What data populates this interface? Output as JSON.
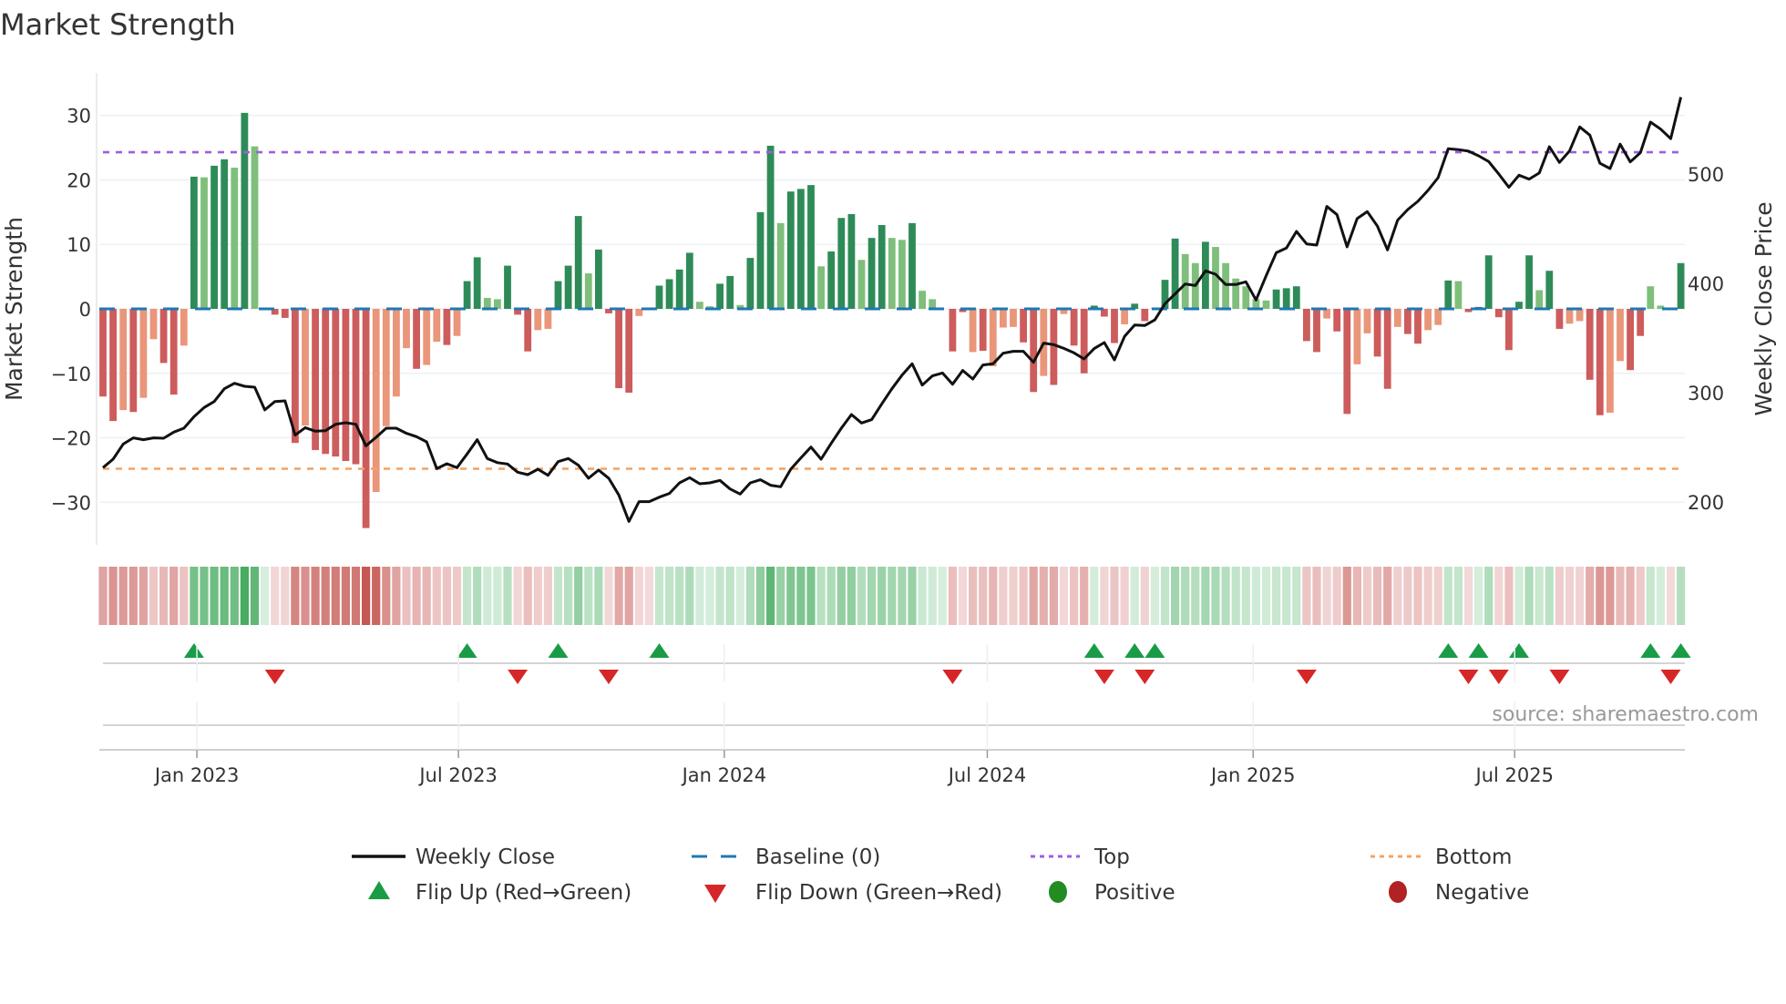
{
  "chart_data": {
    "type": "bar",
    "title": "Market Strength",
    "ylabel": "Market Strength",
    "y2label": "Weekly Close Price",
    "source": "source: sharemaestro.com",
    "start_date": "2022-10-28",
    "frequency": "weekly",
    "ylim": [
      -36.6,
      36.6
    ],
    "y2lim": [
      160.8,
      592.5
    ],
    "yticks": [
      {
        "value": 30,
        "label": "30"
      },
      {
        "value": 20,
        "label": "20"
      },
      {
        "value": 10,
        "label": "10"
      },
      {
        "value": 0,
        "label": "0"
      },
      {
        "value": -10,
        "label": "−10"
      },
      {
        "value": -20,
        "label": "−20"
      },
      {
        "value": -30,
        "label": "−30"
      }
    ],
    "y2ticks": [
      {
        "value": 500,
        "label": "500"
      },
      {
        "value": 400,
        "label": "400"
      },
      {
        "value": 300,
        "label": "300"
      },
      {
        "value": 200,
        "label": "200"
      }
    ],
    "xticks": [
      {
        "date": "2023-01-01",
        "label": "Jan 2023"
      },
      {
        "date": "2023-07-01",
        "label": "Jul 2023"
      },
      {
        "date": "2024-01-01",
        "label": "Jan 2024"
      },
      {
        "date": "2024-07-01",
        "label": "Jul 2024"
      },
      {
        "date": "2025-01-01",
        "label": "Jan 2025"
      },
      {
        "date": "2025-07-01",
        "label": "Jul 2025"
      }
    ],
    "top_level": 24.3,
    "bottom_level": -24.8,
    "baseline": 0,
    "strength": [
      -13.6,
      -17.4,
      -15.7,
      -16.0,
      -13.8,
      -4.7,
      -8.4,
      -13.3,
      -5.7,
      20.5,
      20.4,
      22.2,
      23.2,
      21.9,
      30.4,
      25.2,
      0.0,
      -0.9,
      -1.4,
      -20.8,
      -18.1,
      -21.9,
      -22.5,
      -22.9,
      -23.6,
      -24.1,
      -34.0,
      -28.4,
      -18.2,
      -13.6,
      -6.1,
      -9.3,
      -8.7,
      -5.1,
      -5.6,
      -4.2,
      4.3,
      8.0,
      1.7,
      1.5,
      6.7,
      -0.9,
      -6.6,
      -3.3,
      -3.1,
      4.3,
      6.7,
      14.4,
      5.5,
      9.2,
      -0.7,
      -12.3,
      -13.0,
      -1.1,
      -0.2,
      3.6,
      4.6,
      6.1,
      8.7,
      1.1,
      0.4,
      3.9,
      5.1,
      0.6,
      7.9,
      15.0,
      25.3,
      13.3,
      18.2,
      18.6,
      19.2,
      6.6,
      8.9,
      14.1,
      14.7,
      7.6,
      11.0,
      13.0,
      11.0,
      10.7,
      13.3,
      2.8,
      1.5,
      0.0,
      -6.6,
      -0.5,
      -6.7,
      -6.5,
      -8.9,
      -2.9,
      -2.8,
      -5.2,
      -12.9,
      -10.4,
      -11.8,
      -0.8,
      -5.7,
      -10.0,
      0.5,
      -1.2,
      -5.3,
      -2.4,
      0.8,
      -1.9,
      0.2,
      4.5,
      10.9,
      8.5,
      7.1,
      10.4,
      9.6,
      7.1,
      4.7,
      3.5,
      1.5,
      1.3,
      3.0,
      3.2,
      3.5,
      -5.0,
      -6.7,
      -1.5,
      -3.5,
      -16.3,
      -8.6,
      -3.8,
      -7.4,
      -12.4,
      -2.8,
      -3.9,
      -5.4,
      -3.3,
      -2.5,
      4.4,
      4.3,
      -0.5,
      0.3,
      8.3,
      -1.3,
      -6.4,
      1.1,
      8.3,
      2.9,
      5.9,
      -3.1,
      -2.3,
      -1.9,
      -11.0,
      -16.5,
      -16.1,
      -8.1,
      -9.5,
      -4.2,
      3.5,
      0.5,
      -0.1,
      7.1
    ],
    "strength_shade": "DDLDLLDDLDLDDLDLLDDDLDDDDDDLLLLDLLDLDDLLDDDLLDDDLDDDDLLDDDDLLDDLDDDLDDDLDDDLDDLLDLLLDDLDLLLDDLDLDDDDDLDDLDDLLDLLLLLLDDDDDLDDLLDDLDDLLDLDDDDDDDLDDLLDDLLDDLLLD",
    "weekly_close": [
      231.4,
      239.1,
      253,
      258.6,
      257,
      258.6,
      258.3,
      263.9,
      267.5,
      278,
      286.4,
      291.9,
      303.6,
      308.6,
      305.8,
      305,
      284.2,
      291.9,
      292.5,
      261.1,
      268,
      264.7,
      265.2,
      271.1,
      272.5,
      271.1,
      251.4,
      259.1,
      267.5,
      267.5,
      262.8,
      259.7,
      255,
      230.5,
      235,
      231.4,
      243.9,
      257,
      239.7,
      236,
      234.7,
      227.2,
      225,
      230,
      224.4,
      236.9,
      239.7,
      233.6,
      221.7,
      229.2,
      221.7,
      206.4,
      182.2,
      200.3,
      200.3,
      204.4,
      207.8,
      217.5,
      222.2,
      216.6,
      217.5,
      219.7,
      211.9,
      207.2,
      217.5,
      220.3,
      215.3,
      213.9,
      230,
      240.3,
      250.2,
      239.1,
      253.6,
      267.5,
      280,
      272.2,
      275.3,
      289.7,
      303.6,
      316,
      326.4,
      306.9,
      315.3,
      318,
      307.7,
      320.3,
      312.5,
      325.3,
      326.4,
      336.1,
      337.8,
      337.8,
      327.8,
      345.3,
      343.9,
      340.5,
      336.4,
      330.8,
      340.3,
      345.8,
      330,
      351.4,
      361.9,
      361.4,
      366.6,
      381.4,
      390.3,
      399.4,
      398,
      411.4,
      408.3,
      398.9,
      398.9,
      401.4,
      384.7,
      406.9,
      428,
      432.2,
      447.5,
      436.1,
      435,
      470.3,
      462.8,
      433.4,
      459.2,
      465.6,
      452.3,
      430.6,
      457.8,
      467.5,
      475,
      485,
      496.7,
      523.1,
      522.3,
      520.9,
      516.7,
      511.4,
      500,
      487.8,
      498.9,
      495.3,
      500.9,
      525,
      510.6,
      521.2,
      543.1,
      535.6,
      509.8,
      505,
      527.3,
      511.1,
      519.5,
      547.5,
      541.1,
      532.3,
      570.3
    ],
    "flip_up_weeks": [
      9,
      36,
      45,
      55,
      98,
      102,
      104,
      133,
      136,
      140,
      153,
      156
    ],
    "flip_down_weeks": [
      17,
      41,
      50,
      84,
      99,
      103,
      119,
      135,
      138,
      144,
      155
    ],
    "legend": {
      "placement": "bottom",
      "items": [
        {
          "label": "Weekly Close"
        },
        {
          "label": "Baseline (0)"
        },
        {
          "label": "Top"
        },
        {
          "label": "Bottom"
        },
        {
          "label": "Flip Up (Red→Green)"
        },
        {
          "label": "Flip Down (Green→Red)"
        },
        {
          "label": "Positive"
        },
        {
          "label": "Negative"
        }
      ]
    },
    "colors": {
      "pos_strong": "#2e8b57",
      "pos_weak": "#7fbf7b",
      "neg_strong": "#cd5c5c",
      "neg_weak": "#e9967a",
      "close": "#111111",
      "baseline": "#1f77b4",
      "top": "#9b5fe0",
      "bottom": "#f4a261",
      "flip_up": "#1a9c47",
      "flip_down": "#d62728",
      "positive": "#228b22",
      "negative": "#b22222"
    }
  }
}
